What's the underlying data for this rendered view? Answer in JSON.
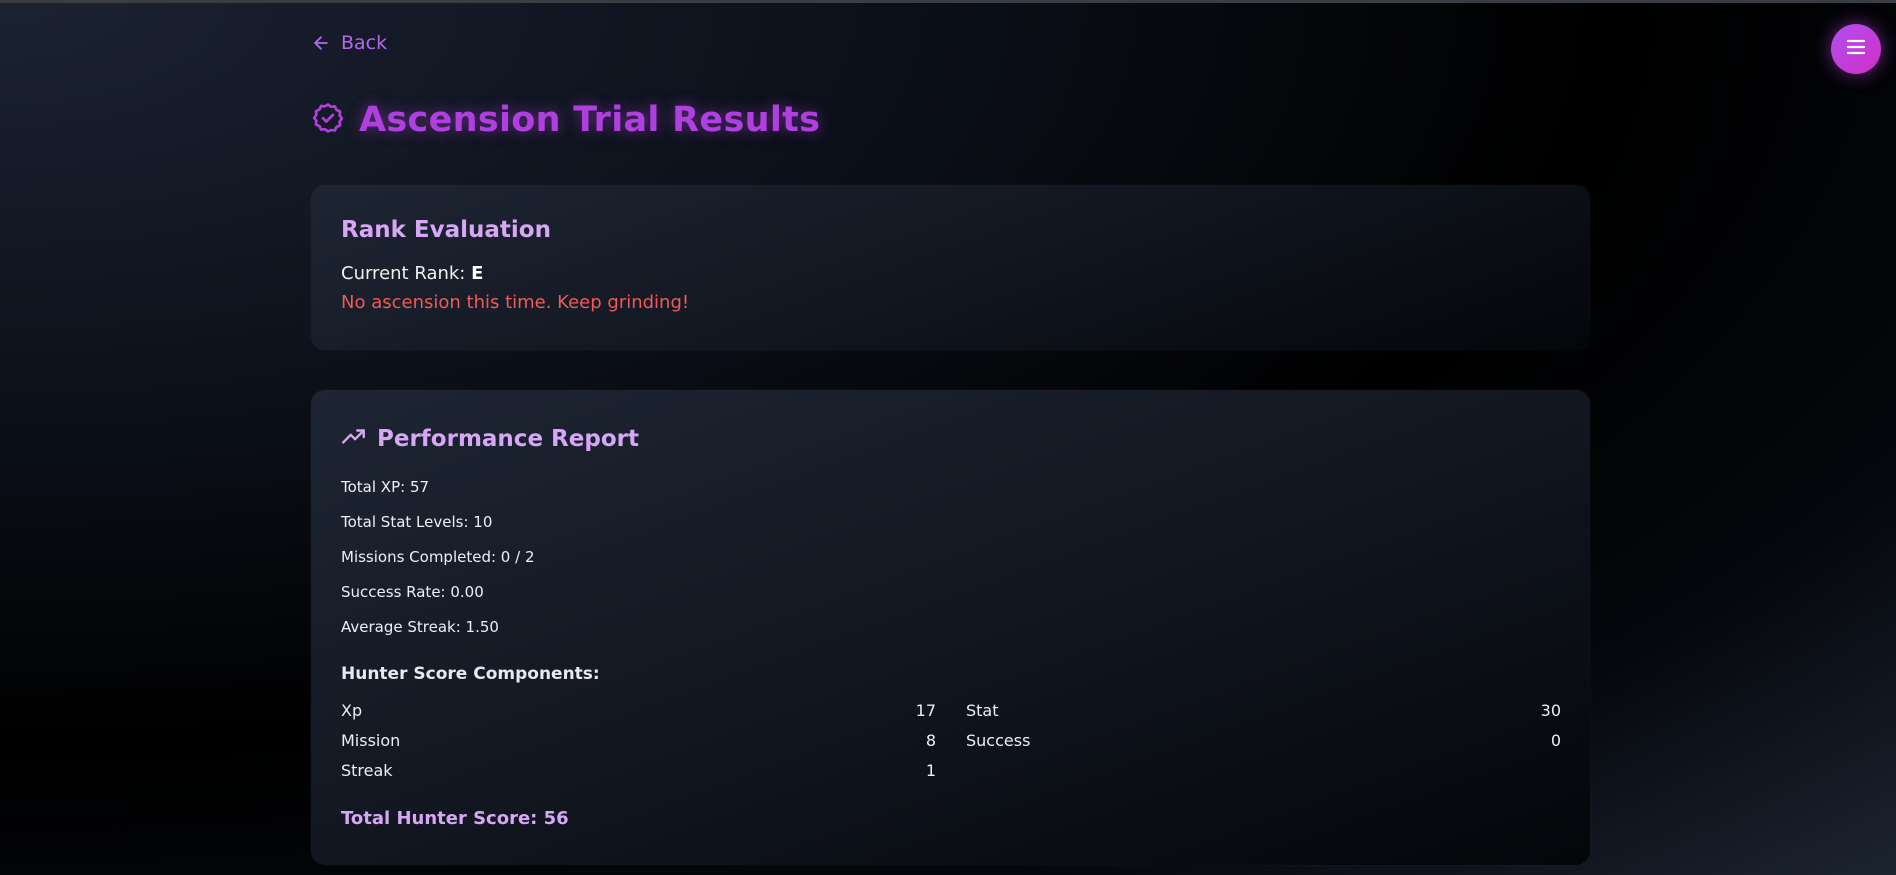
{
  "nav": {
    "back_label": "Back"
  },
  "header": {
    "title": "Ascension Trial Results"
  },
  "rank_card": {
    "title": "Rank Evaluation",
    "current_rank_label": "Current Rank:",
    "current_rank_value": "E",
    "message": "No ascension this time. Keep grinding!"
  },
  "performance": {
    "title": "Performance Report",
    "stats": [
      "Total XP: 57",
      "Total Stat Levels: 10",
      "Missions Completed: 0 / 2",
      "Success Rate: 0.00",
      "Average Streak: 1.50"
    ],
    "components_heading": "Hunter Score Components:",
    "components": [
      {
        "label": "Xp",
        "value": "17"
      },
      {
        "label": "Stat",
        "value": "30"
      },
      {
        "label": "Mission",
        "value": "8"
      },
      {
        "label": "Success",
        "value": "0"
      },
      {
        "label": "Streak",
        "value": "1"
      }
    ],
    "total_score": "Total Hunter Score: 56"
  },
  "colors": {
    "accent": "#b03fe0",
    "accent_light": "#d7a6f5",
    "warning": "#f05a5a"
  },
  "icons": [
    "arrow-left-icon",
    "menu-icon",
    "badge-check-icon",
    "trending-up-icon"
  ]
}
